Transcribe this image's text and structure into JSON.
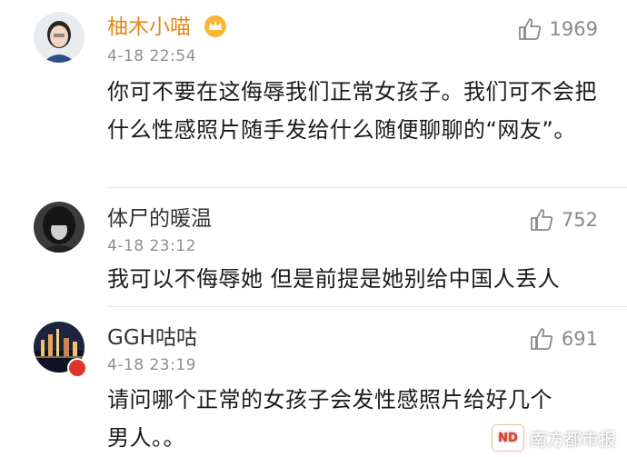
{
  "comments": [
    {
      "user": "柚木小喵",
      "time": "4-18 22:54",
      "likes": "1969",
      "text": "你可不要在这侮辱我们正常女孩子。我们可不会把什么性感照片随手发给什么随便聊聊的“网友”。"
    },
    {
      "user": "体尸的暖温",
      "time": "4-18 23:12",
      "likes": "752",
      "text": "我可以不侮辱她 但是前提是她别给中国人丢人"
    },
    {
      "user": "GGH咕咕",
      "time": "4-18 23:19",
      "likes": "691",
      "text": "请问哪个正常的女孩子会发性感照片给好几个男人。。"
    }
  ],
  "watermark": {
    "text": "南方都市报",
    "logo_text": "ND"
  },
  "colors": {
    "name_highlight": "#e08a1e",
    "name_normal": "#333333",
    "meta": "#8f8f8f",
    "badge_red": "#e0352b"
  }
}
